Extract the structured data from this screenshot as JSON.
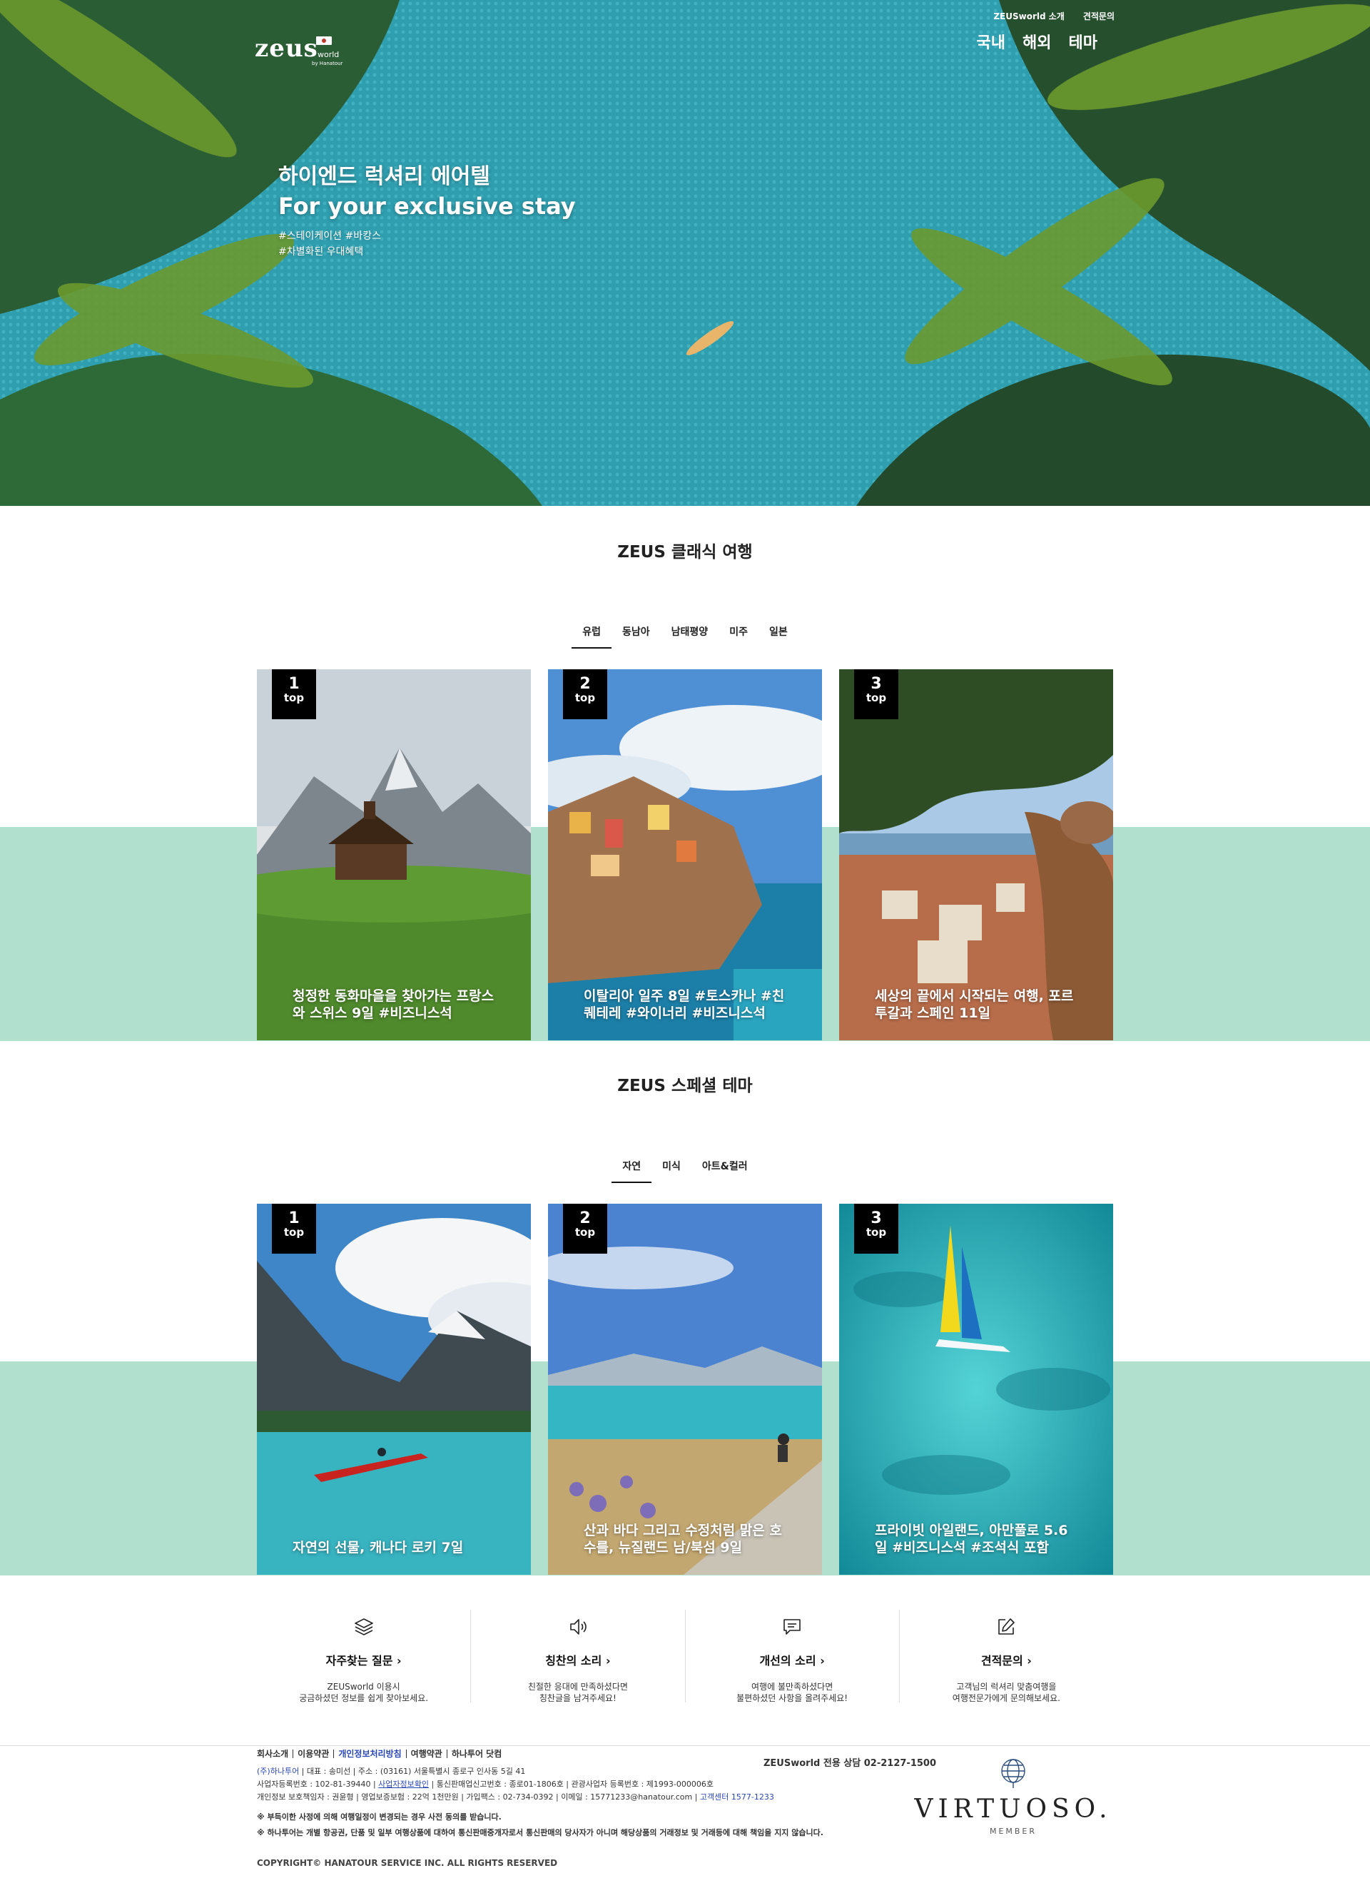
{
  "brand": {
    "logo_text": "zeus",
    "logo_world": "world",
    "logo_by": "by Hanatour"
  },
  "util_links": [
    "ZEUSworld 소개",
    "견적문의"
  ],
  "gnb": [
    "국내",
    "해외",
    "테마"
  ],
  "hero": {
    "title_ko": "하이엔드 럭셔리 에어텔",
    "title_en": "For your exclusive stay",
    "tags_line1": "#스테이케이션 #바캉스",
    "tags_line2": "#차별화된 우대혜택"
  },
  "classic": {
    "title": "ZEUS 클래식 여행",
    "tabs": [
      "유럽",
      "동남아",
      "남태평양",
      "미주",
      "일본"
    ],
    "active_tab": "유럽",
    "cards": [
      {
        "rank": "1",
        "rank_label": "top",
        "caption": "청정한 동화마을을 찾아가는 프랑스와 스위스 9일 #비즈니스석"
      },
      {
        "rank": "2",
        "rank_label": "top",
        "caption": "이탈리아 일주 8일 #토스카나 #친퀘테레 #와이너리 #비즈니스석"
      },
      {
        "rank": "3",
        "rank_label": "top",
        "caption": "세상의 끝에서 시작되는 여행, 포르투갈과 스페인 11일"
      }
    ]
  },
  "special": {
    "title": "ZEUS 스페셜 테마",
    "tabs": [
      "자연",
      "미식",
      "아트&컬러"
    ],
    "active_tab": "자연",
    "cards": [
      {
        "rank": "1",
        "rank_label": "top",
        "caption": "자연의 선물, 캐나다 로키 7일"
      },
      {
        "rank": "2",
        "rank_label": "top",
        "caption": "산과 바다 그리고 수정처럼 맑은 호수를, 뉴질랜드 남/북섬 9일"
      },
      {
        "rank": "3",
        "rank_label": "top",
        "caption": "프라이빗 아일랜드, 아만풀로 5.6일 #비즈니스석 #조석식 포함"
      }
    ]
  },
  "cs_links": [
    {
      "title": "자주찾는 질문 ›",
      "desc": "ZEUSworld 이용시\n궁금하셨던 정보를 쉽게 찾아보세요.",
      "icon": "layers-icon"
    },
    {
      "title": "칭찬의 소리 ›",
      "desc": "친절한 응대에 만족하셨다면\n칭찬글을 남겨주세요!",
      "icon": "speaker-icon"
    },
    {
      "title": "개선의 소리 ›",
      "desc": "여행에 불만족하셨다면\n불편하셨던 사항을 올려주세요!",
      "icon": "message-icon"
    },
    {
      "title": "견적문의 ›",
      "desc": "고객님의 럭셔리 맞춤여행을\n여행전문가에게 문의해보세요.",
      "icon": "edit-icon"
    }
  ],
  "footer": {
    "links": [
      "회사소개",
      "이용약관",
      "개인정보처리방침",
      "여행약관",
      "하나투어 닷컴"
    ],
    "consult": "ZEUSworld 전용 상담 02-2127-1500",
    "company": "(주)하나투어",
    "info1": " | 대표 : 송미선 | 주소 : (03161) 서울특별시 종로구 인사동 5길 41",
    "info2": "사업자등록번호 : 102-81-39440 | ",
    "info2_link": "사업자정보확인",
    "info2_rest": " | 통신판매업신고번호 : 종로01-1806호 | 관광사업자 등록번호 : 제1993-000006호",
    "info3": "개인정보 보호책임자 : 권윤형 | 영업보증보험 : 22억 1천만원 | 가입팩스 : 02-734-0392 | 이메일 : 15771233@hanatour.com | ",
    "info3_link": "고객센터 1577-1233",
    "notice1": "※ 부득이한 사정에 의해 여행일정이 변경되는 경우 사전 동의를 받습니다.",
    "notice2": "※ 하나투어는 개별 항공권, 단품 및 일부 여행상품에 대하여 통신판매중개자로서 통신판매의 당사자가 아니며 해당상품의 거래정보 및 거래등에 대해 책임을 지지 않습니다.",
    "copyright": "COPYRIGHT© HANATOUR SERVICE INC. ALL RIGHTS RESERVED",
    "virtuoso": "VIRTUOSO.",
    "virtuoso_member": "MEMBER"
  },
  "colors": {
    "mint": "#b2e0cf",
    "active_tab": "#111111",
    "link_blue": "#2a47b8"
  }
}
